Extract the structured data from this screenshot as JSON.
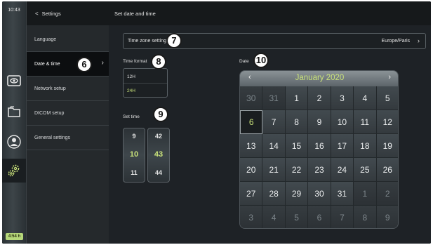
{
  "status": {
    "clock": "10:43",
    "battery": "4:54 h"
  },
  "rail": {
    "icons": [
      "camera-icon",
      "folder-icon",
      "user-icon",
      "settings-gears-icon"
    ],
    "active": "settings-gears-icon"
  },
  "menu": {
    "title": "Settings",
    "items": [
      {
        "label": "Language"
      },
      {
        "label": "Date & time",
        "active": true
      },
      {
        "label": "Network setup"
      },
      {
        "label": "DICOM setup"
      },
      {
        "label": "General settings"
      }
    ]
  },
  "content": {
    "title": "Set date and time",
    "timezone": {
      "label": "Time zone setting",
      "value": "Europe/Paris"
    },
    "time_format": {
      "label": "Time format",
      "options": [
        "12H",
        "24H"
      ],
      "selected": "24H"
    },
    "set_time": {
      "label": "Set time",
      "hour": {
        "prev": "9",
        "current": "10",
        "next": "11"
      },
      "minute": {
        "prev": "42",
        "current": "43",
        "next": "44"
      }
    },
    "date": {
      "label": "Date",
      "month_title": "January 2020",
      "selected_day": "6",
      "days": [
        {
          "d": "30",
          "m": true
        },
        {
          "d": "31",
          "m": true
        },
        {
          "d": "1"
        },
        {
          "d": "2"
        },
        {
          "d": "3"
        },
        {
          "d": "4"
        },
        {
          "d": "5"
        },
        {
          "d": "6",
          "s": true
        },
        {
          "d": "7"
        },
        {
          "d": "8"
        },
        {
          "d": "9"
        },
        {
          "d": "10"
        },
        {
          "d": "11"
        },
        {
          "d": "12"
        },
        {
          "d": "13"
        },
        {
          "d": "14"
        },
        {
          "d": "15"
        },
        {
          "d": "16"
        },
        {
          "d": "17"
        },
        {
          "d": "18"
        },
        {
          "d": "19"
        },
        {
          "d": "20"
        },
        {
          "d": "21"
        },
        {
          "d": "22"
        },
        {
          "d": "23"
        },
        {
          "d": "24"
        },
        {
          "d": "25"
        },
        {
          "d": "26"
        },
        {
          "d": "27"
        },
        {
          "d": "28"
        },
        {
          "d": "29"
        },
        {
          "d": "30"
        },
        {
          "d": "31"
        },
        {
          "d": "1",
          "m": true
        },
        {
          "d": "2",
          "m": true
        },
        {
          "d": "3",
          "m": true
        },
        {
          "d": "4",
          "m": true
        },
        {
          "d": "5",
          "m": true
        },
        {
          "d": "6",
          "m": true
        },
        {
          "d": "7",
          "m": true
        },
        {
          "d": "8",
          "m": true
        },
        {
          "d": "9",
          "m": true
        }
      ]
    }
  },
  "callouts": [
    "6",
    "7",
    "8",
    "9",
    "10"
  ],
  "colors": {
    "accent": "#c9e27a",
    "background": "#1e2226",
    "header": "#16191b"
  }
}
